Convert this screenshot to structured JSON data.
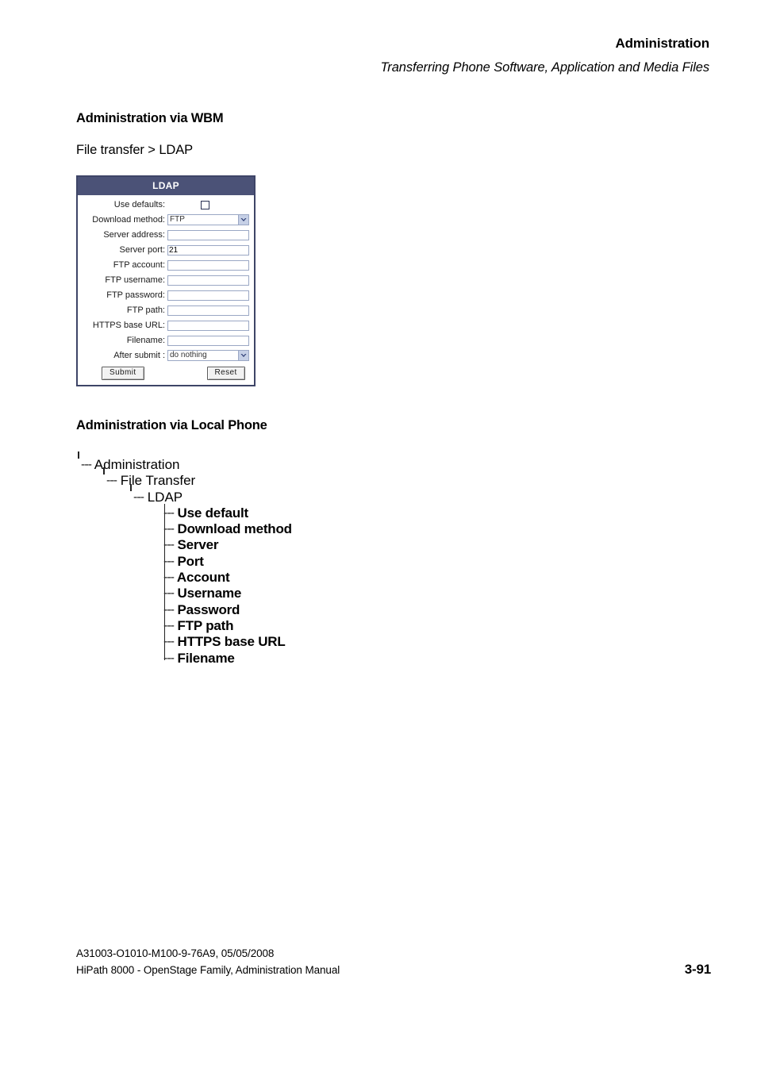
{
  "running_head": {
    "title": "Administration",
    "subtitle": "Transferring Phone Software, Application and Media Files"
  },
  "sections": {
    "wbm_heading": "Administration via WBM",
    "breadcrumb": "File transfer > LDAP",
    "local_phone_heading": "Administration via Local Phone"
  },
  "ldap_panel": {
    "title": "LDAP",
    "colors": {
      "titlebar_bg": "#4b5277",
      "panel_border": "#3e4567",
      "field_border": "#9aa7c4",
      "arrow_bg": "#c6d0e6"
    },
    "fields": [
      {
        "label": "Use defaults:",
        "type": "checkbox",
        "value": "",
        "checked": false
      },
      {
        "label": "Download method:",
        "type": "select",
        "value": "FTP"
      },
      {
        "label": "Server address:",
        "type": "text",
        "value": ""
      },
      {
        "label": "Server port:",
        "type": "text",
        "value": "21"
      },
      {
        "label": "FTP account:",
        "type": "text",
        "value": ""
      },
      {
        "label": "FTP username:",
        "type": "text",
        "value": ""
      },
      {
        "label": "FTP password:",
        "type": "text",
        "value": ""
      },
      {
        "label": "FTP path:",
        "type": "text",
        "value": ""
      },
      {
        "label": "HTTPS base URL:",
        "type": "text",
        "value": ""
      },
      {
        "label": "Filename:",
        "type": "text",
        "value": ""
      },
      {
        "label": "After submit :",
        "type": "select",
        "value": "do nothing"
      }
    ],
    "buttons": {
      "submit": "Submit",
      "reset": "Reset"
    }
  },
  "tree": {
    "dash": "---",
    "level1": "Administration",
    "level2": "File Transfer",
    "level3": "LDAP",
    "leaves": [
      "Use default",
      "Download method",
      "Server",
      "Port",
      "Account",
      "Username",
      "Password",
      "FTP path",
      "HTTPS base URL",
      "Filename"
    ]
  },
  "footer": {
    "line1": "A31003-O1010-M100-9-76A9, 05/05/2008",
    "line2": "HiPath 8000 - OpenStage Family, Administration Manual",
    "page": "3-91"
  }
}
